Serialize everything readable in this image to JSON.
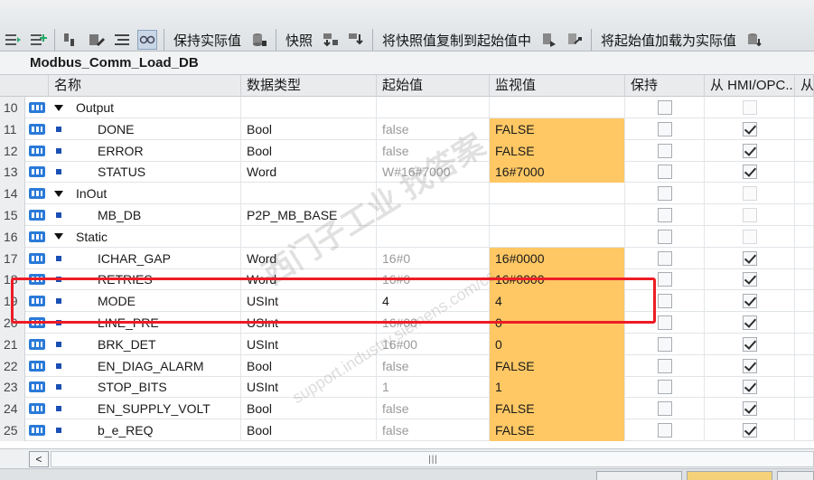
{
  "toolbar": {
    "keep_actual_label": "保持实际值",
    "snapshot_label": "快照",
    "copy_snapshot_label": "将快照值复制到起始值中",
    "load_start_label": "将起始值加载为实际值"
  },
  "block": {
    "title": "Modbus_Comm_Load_DB"
  },
  "columns": {
    "name": "名称",
    "type": "数据类型",
    "start": "起始值",
    "monitor": "监视值",
    "retain": "保持",
    "hmi": "从 HMI/OPC...",
    "from": "从"
  },
  "rows": [
    {
      "n": "10",
      "kind": "section",
      "name": "Output",
      "type": "",
      "start": "",
      "mon": "",
      "retain": false,
      "hmi": false,
      "hmi_dim": true
    },
    {
      "n": "11",
      "kind": "item",
      "name": "DONE",
      "type": "Bool",
      "start": "false",
      "mon": "FALSE",
      "retain": false,
      "hmi": true
    },
    {
      "n": "12",
      "kind": "item",
      "name": "ERROR",
      "type": "Bool",
      "start": "false",
      "mon": "FALSE",
      "retain": false,
      "hmi": true
    },
    {
      "n": "13",
      "kind": "item",
      "name": "STATUS",
      "type": "Word",
      "start": "W#16#7000",
      "mon": "16#7000",
      "retain": false,
      "hmi": true
    },
    {
      "n": "14",
      "kind": "section",
      "name": "InOut",
      "type": "",
      "start": "",
      "mon": "",
      "retain": false,
      "hmi": false,
      "hmi_dim": true
    },
    {
      "n": "15",
      "kind": "item",
      "name": "MB_DB",
      "type": "P2P_MB_BASE",
      "start": "",
      "mon": "",
      "retain": false,
      "hmi": false,
      "hmi_dim": true
    },
    {
      "n": "16",
      "kind": "section",
      "name": "Static",
      "type": "",
      "start": "",
      "mon": "",
      "retain": false,
      "hmi": false,
      "hmi_dim": true
    },
    {
      "n": "17",
      "kind": "item",
      "name": "ICHAR_GAP",
      "type": "Word",
      "start": "16#0",
      "mon": "16#0000",
      "retain": false,
      "hmi": true
    },
    {
      "n": "18",
      "kind": "item",
      "name": "RETRIES",
      "type": "Word",
      "start": "16#0",
      "mon": "16#0000",
      "retain": false,
      "hmi": true
    },
    {
      "n": "19",
      "kind": "item",
      "name": "MODE",
      "type": "USInt",
      "start": "4",
      "start_plain": true,
      "mon": "4",
      "retain": false,
      "hmi": true
    },
    {
      "n": "20",
      "kind": "item",
      "name": "LINE_PRE",
      "type": "USInt",
      "start": "16#00",
      "mon": "0",
      "retain": false,
      "hmi": true
    },
    {
      "n": "21",
      "kind": "item",
      "name": "BRK_DET",
      "type": "USInt",
      "start": "16#00",
      "mon": "0",
      "retain": false,
      "hmi": true
    },
    {
      "n": "22",
      "kind": "item",
      "name": "EN_DIAG_ALARM",
      "type": "Bool",
      "start": "false",
      "mon": "FALSE",
      "retain": false,
      "hmi": true
    },
    {
      "n": "23",
      "kind": "item",
      "name": "STOP_BITS",
      "type": "USInt",
      "start": "1",
      "mon": "1",
      "retain": false,
      "hmi": true
    },
    {
      "n": "24",
      "kind": "item",
      "name": "EN_SUPPLY_VOLT",
      "type": "Bool",
      "start": "false",
      "mon": "FALSE",
      "retain": false,
      "hmi": true
    },
    {
      "n": "25",
      "kind": "item",
      "name": "b_e_REQ",
      "type": "Bool",
      "start": "false",
      "mon": "FALSE",
      "retain": false,
      "hmi": true
    }
  ],
  "watermark": {
    "main": "西门子工业 找答案",
    "url": "support.industry.siemens.com/cs"
  },
  "scroll": {
    "left_arrow": "<",
    "thumb_grip": "|||"
  },
  "colors": {
    "monitor_bg": "#ffc864",
    "highlight": "#ee1c25",
    "bullet": "#1a4fb3"
  }
}
